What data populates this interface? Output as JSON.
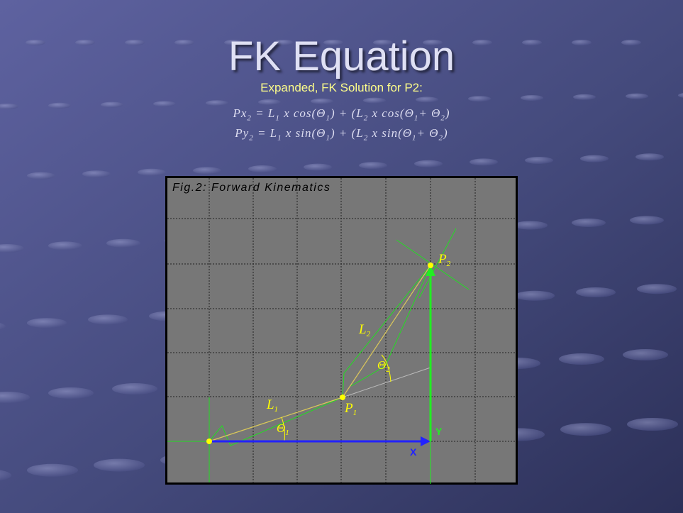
{
  "slide": {
    "title": "FK Equation",
    "subtitle": "Expanded, FK Solution for P2:"
  },
  "equations": [
    {
      "lhs": "Px",
      "lhs_sub": "2",
      "text": [
        "= L",
        "1",
        " x cos(Θ",
        "1",
        ") + (L",
        "2",
        " x cos(Θ",
        "1",
        "+ Θ",
        "2",
        ")"
      ]
    },
    {
      "lhs": "Py",
      "lhs_sub": "2",
      "text": [
        "= L",
        "1",
        " x sin(Θ",
        "1",
        ") + (L",
        "2",
        " x sin(Θ",
        "1",
        "+ Θ",
        "2",
        ")"
      ]
    }
  ],
  "figure": {
    "caption": "Fig.2: Forward Kinematics",
    "labels": {
      "L1": "L",
      "L1_sub": "1",
      "L2": "L",
      "L2_sub": "2",
      "theta1": "Θ",
      "theta1_sub": "1",
      "theta2": "Θ",
      "theta2_sub": "2",
      "P1": "P",
      "P1_sub": "1",
      "P2": "P",
      "P2_sub": "2",
      "x_axis": "X",
      "y_axis": "Y"
    },
    "colors": {
      "panel": "#777777",
      "link": "#e0c060",
      "highlight": "#ffff00",
      "construction": "#22dd22",
      "x_axis": "#2222ff",
      "y_axis": "#22ee22"
    }
  }
}
